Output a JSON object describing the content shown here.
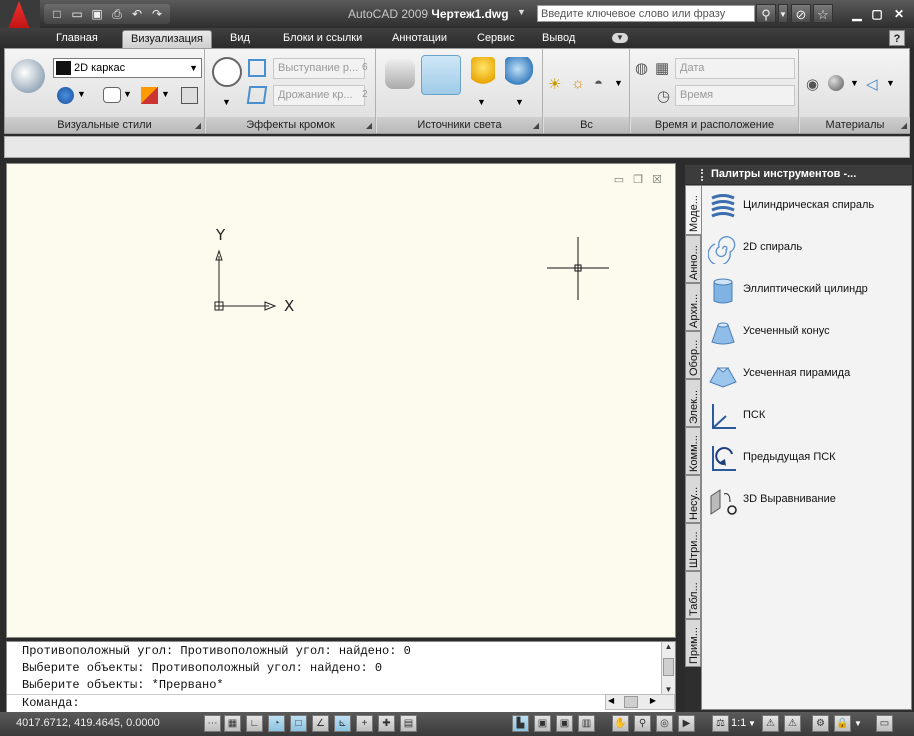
{
  "titlebar": {
    "app_name": "AutoCAD 2009",
    "document": "Чертеж1.dwg",
    "search_placeholder": "Введите ключевое слово или фразу"
  },
  "tabs": [
    "Главная",
    "Визуализация",
    "Вид",
    "Блоки и ссылки",
    "Аннотации",
    "Сервис",
    "Вывод"
  ],
  "active_tab": "Визуализация",
  "ribbon": {
    "visual_style_value": "2D каркас",
    "edge_jitter_label": "Выступание р...",
    "edge_jitter_value": "6",
    "edge_wobble_label": "Дрожание кр...",
    "edge_wobble_value": "2",
    "date_label": "Дата",
    "time_label": "Время",
    "panels": {
      "visual_styles": "Визуальные стили",
      "edge_effects": "Эффекты кромок",
      "lights": "Источники света",
      "sun": "Вс",
      "time_location": "Время и расположение",
      "materials": "Материалы"
    }
  },
  "drawing": {
    "ucs_x": "X",
    "ucs_y": "Y"
  },
  "command": {
    "lines": [
      "Противоположный угол: Противоположный угол: найдено: 0",
      "Выберите объекты: Противоположный угол: найдено: 0",
      "Выберите объекты: *Прервано*"
    ],
    "prompt": "Команда:"
  },
  "status": {
    "coords": "4017.6712, 419.4645, 0.0000",
    "scale": "1:1"
  },
  "palette": {
    "title": "Палитры инструментов -...",
    "tabs": [
      "Моде...",
      "Анно...",
      "Архи...",
      "Обор...",
      "Элек...",
      "Комм...",
      "Несу...",
      "Штри...",
      "Табл...",
      "Прим..."
    ],
    "items": [
      {
        "label": "Цилиндрическая спираль",
        "icon": "helix-icon"
      },
      {
        "label": "2D спираль",
        "icon": "spiral-icon"
      },
      {
        "label": "Эллиптический цилиндр",
        "icon": "elliptic-cylinder-icon"
      },
      {
        "label": "Усеченный конус",
        "icon": "frustum-cone-icon"
      },
      {
        "label": "Усеченная пирамида",
        "icon": "frustum-pyramid-icon"
      },
      {
        "label": "ПСК",
        "icon": "ucs-icon"
      },
      {
        "label": "Предыдущая ПСК",
        "icon": "ucs-previous-icon"
      },
      {
        "label": "3D Выравнивание",
        "icon": "3d-align-icon"
      }
    ]
  }
}
